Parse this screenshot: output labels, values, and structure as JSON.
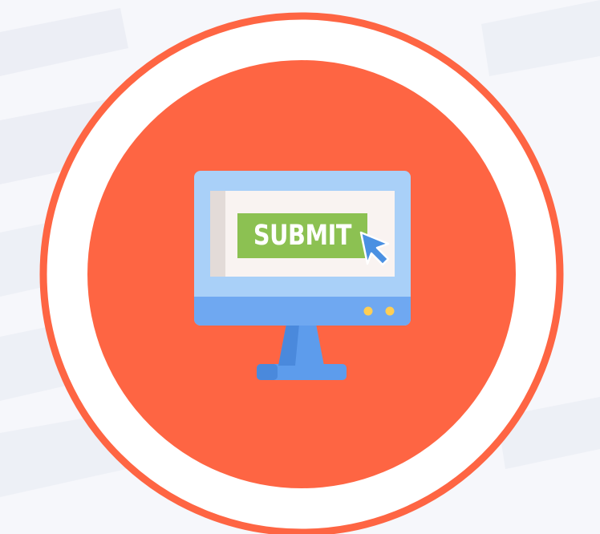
{
  "scene": {
    "button_label": "SUBMIT",
    "icons": [
      "desktop-monitor-icon",
      "submit-button-icon",
      "mouse-cursor-icon"
    ],
    "colors": {
      "background": "#f6f7fb",
      "stripe": "#eceef5",
      "ring": "#fe6543",
      "disc": "#fe6543",
      "ring_gap": "#ffffff",
      "monitor_frame": "#a9d0f8",
      "monitor_bezel": "#6fa8f1",
      "screen": "#f9f3f1",
      "screen_shadow": "#e3dbd8",
      "submit_green": "#8cc152",
      "cursor": "#4a90e2",
      "indicator": "#ffce54",
      "stand": "#5d9cec"
    }
  }
}
